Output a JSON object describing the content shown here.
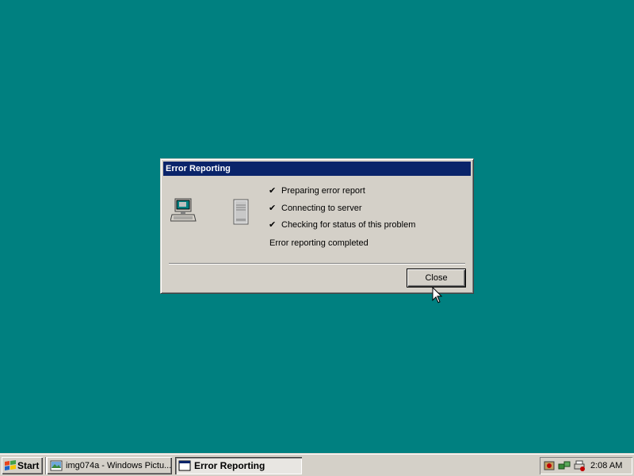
{
  "dialog": {
    "title": "Error Reporting",
    "steps": [
      {
        "check": "✔",
        "label": "Preparing error report"
      },
      {
        "check": "✔",
        "label": "Connecting to server"
      },
      {
        "check": "✔",
        "label": "Checking for status of this problem"
      }
    ],
    "status": "Error reporting completed",
    "close_label": "Close"
  },
  "taskbar": {
    "start_label": "Start",
    "tasks": [
      {
        "label": "img074a - Windows Pictu...",
        "icon": "picture-viewer-icon"
      },
      {
        "label": "Error Reporting",
        "icon": "window-icon"
      }
    ],
    "clock": "2:08 AM",
    "tray_icons": [
      "security-icon",
      "network-icon",
      "printer-icon"
    ]
  },
  "colors": {
    "desktop": "#008080",
    "titlebar": "#0a246a",
    "face": "#d4d0c8"
  }
}
